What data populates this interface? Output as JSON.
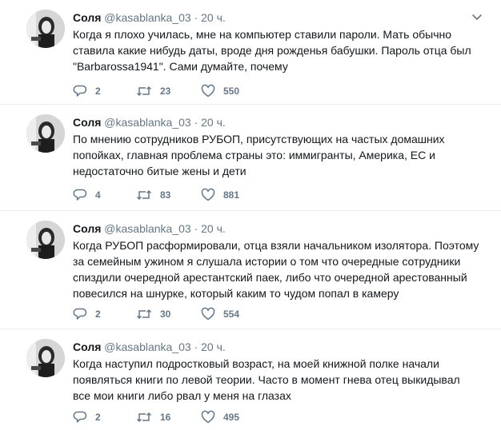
{
  "tweets": [
    {
      "name": "Соля",
      "handle": "@kasablanka_03",
      "dot": "·",
      "time": "20 ч.",
      "text": "Когда я плохо училась, мне на компьютер ставили пароли. Мать обычно\nставила какие нибудь даты, вроде дня рожденья бабушки. Пароль отца был\n\"Barbarossa1941\". Сами думайте, почему",
      "replies": "2",
      "retweets": "23",
      "likes": "550"
    },
    {
      "name": "Соля",
      "handle": "@kasablanka_03",
      "dot": "·",
      "time": "20 ч.",
      "text": "По мнению сотрудников РУБОП, присутствующих на частых домашних\nпопойках, главная проблема страны это: иммигранты, Америка, ЕС и\nнедостаточно битые жены и дети",
      "replies": "4",
      "retweets": "83",
      "likes": "881"
    },
    {
      "name": "Соля",
      "handle": "@kasablanka_03",
      "dot": "·",
      "time": "20 ч.",
      "text": "Когда РУБОП расформировали, отца взяли начальником изолятора. Поэтому\nза семейным ужином я слушала истории о том что очередные сотрудники\nспиздили очередной арестантский паек, либо что очередной арестованный\nповесился на шнурке, который каким то чудом попал в камеру",
      "replies": "2",
      "retweets": "30",
      "likes": "554"
    },
    {
      "name": "Соля",
      "handle": "@kasablanka_03",
      "dot": "·",
      "time": "20 ч.",
      "text": "Когда наступил подростковый возраст, на моей книжной полке начали\nпоявляться книги по левой теории. Часто в момент гнева отец выкидывал\nвсе мои книги либо рвал у меня на глазах",
      "replies": "2",
      "retweets": "16",
      "likes": "495"
    }
  ],
  "icons": {
    "avatar": "avatar-photo",
    "more": "chevron-down-icon",
    "reply": "reply-icon",
    "retweet": "retweet-icon",
    "like": "heart-icon"
  },
  "colors": {
    "text": "#14171a",
    "secondary": "#657786",
    "divider": "#e6ecf0"
  }
}
